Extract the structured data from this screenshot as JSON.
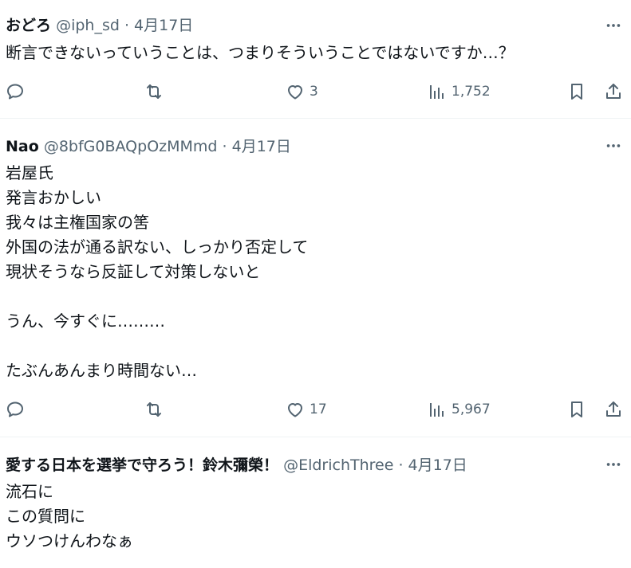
{
  "tweets": [
    {
      "name": "おどろ",
      "handle": "@iph_sd",
      "separator": "·",
      "date": "4月17日",
      "lines": [
        "断言できないっていうことは、つまりそういうことではないですか…？"
      ],
      "likes": "3",
      "views": "1,752"
    },
    {
      "name": "Nao",
      "handle": "@8bfG0BAQpOzMMmd",
      "separator": "·",
      "date": "4月17日",
      "lines": [
        "岩屋氏",
        "発言おかしい",
        "我々は主権国家の筈",
        "外国の法が通る訳ない、しっかり否定して",
        "現状そうなら反証して対策しないと",
        "",
        "うん、今すぐに………",
        "",
        "たぶんあんまり時間ない…"
      ],
      "likes": "17",
      "views": "5,967"
    },
    {
      "name": "愛する日本を選挙で守ろう！鈴木彌榮！",
      "handle": "@EldrichThree",
      "separator": "·",
      "date": "4月17日",
      "lines": [
        "流石に",
        "この質問に",
        "ウソつけんわなぁ"
      ]
    }
  ],
  "colors": {
    "text": "#0f1419",
    "secondary": "#536471",
    "divider": "#eff3f4"
  }
}
